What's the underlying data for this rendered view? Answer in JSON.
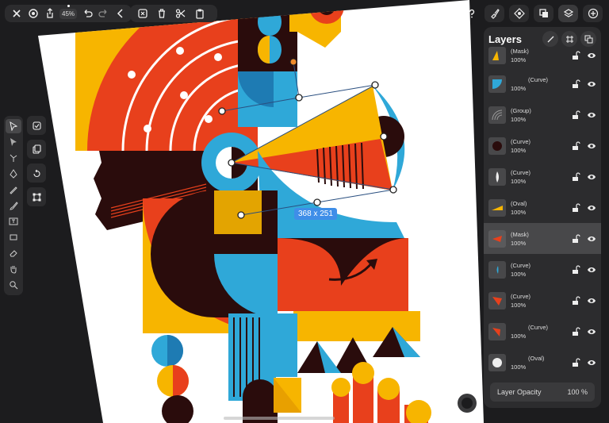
{
  "toolbar": {
    "zoom": "45%"
  },
  "canvas": {
    "selection_dimensions": "368 x 251"
  },
  "layers_panel": {
    "title": "Layers",
    "items": [
      {
        "name": "(Mask)",
        "opacity": "100%",
        "thumb": "yellow-shape"
      },
      {
        "name": "(Curve)",
        "opacity": "100%",
        "thumb": "blue-quarter"
      },
      {
        "name": "(Group)",
        "opacity": "100%",
        "thumb": "arcs"
      },
      {
        "name": "(Curve)",
        "opacity": "100%",
        "thumb": "dark-circle"
      },
      {
        "name": "(Curve)",
        "opacity": "100%",
        "thumb": "white-lens"
      },
      {
        "name": "(Oval)",
        "opacity": "100%",
        "thumb": "yellow-triangle"
      },
      {
        "name": "(Mask)",
        "opacity": "100%",
        "thumb": "red-arrow"
      },
      {
        "name": "(Curve)",
        "opacity": "100%",
        "thumb": "blue-sliver"
      },
      {
        "name": "(Curve)",
        "opacity": "100%",
        "thumb": "red-triangle"
      },
      {
        "name": "(Curve)",
        "opacity": "100%",
        "thumb": "red-triangle"
      },
      {
        "name": "(Oval)",
        "opacity": "100%",
        "thumb": "white-circle"
      }
    ],
    "opacity_label": "Layer Opacity",
    "opacity_value": "100 %"
  },
  "colors": {
    "orange_red": "#e8401c",
    "yellow": "#f7b500",
    "blue": "#2fa8d8",
    "dark": "#2a0c0c",
    "selection": "#3f8ee8"
  }
}
